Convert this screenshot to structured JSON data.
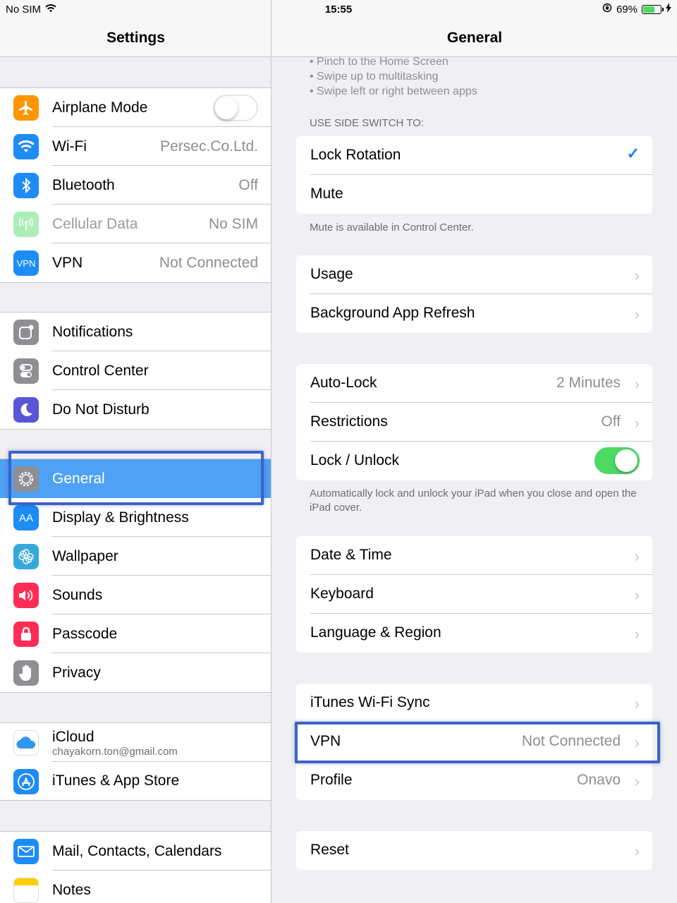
{
  "status": {
    "carrier": "No SIM",
    "time": "15:55",
    "battery": "69%",
    "battery_level": 0.69
  },
  "master": {
    "title": "Settings",
    "group1": [
      {
        "label": "Airplane Mode",
        "icon": "airplane-icon",
        "color": "#ff9500",
        "toggle": false
      },
      {
        "label": "Wi-Fi",
        "value": "Persec.Co.Ltd.",
        "icon": "wifi-icon",
        "color": "#1e8cf5"
      },
      {
        "label": "Bluetooth",
        "value": "Off",
        "icon": "bluetooth-icon",
        "color": "#1e8cf5"
      },
      {
        "label": "Cellular Data",
        "value": "No SIM",
        "icon": "cellular-icon",
        "color": "#4cd964",
        "disabled": true
      },
      {
        "label": "VPN",
        "value": "Not Connected",
        "icon": "vpn-icon",
        "color": "#1e8cf5",
        "icon_text": "VPN"
      }
    ],
    "group2": [
      {
        "label": "Notifications",
        "icon": "notifications-icon",
        "color": "#8e8e93"
      },
      {
        "label": "Control Center",
        "icon": "control-center-icon",
        "color": "#8e8e93"
      },
      {
        "label": "Do Not Disturb",
        "icon": "moon-icon",
        "color": "#5856d6"
      }
    ],
    "group3": [
      {
        "label": "General",
        "icon": "gear-icon",
        "color": "#8e8e93",
        "selected": true
      },
      {
        "label": "Display & Brightness",
        "icon": "display-icon",
        "color": "#1e8cf5",
        "icon_text": "AA"
      },
      {
        "label": "Wallpaper",
        "icon": "wallpaper-icon",
        "color": "#34aadc"
      },
      {
        "label": "Sounds",
        "icon": "speaker-icon",
        "color": "#ff2d55"
      },
      {
        "label": "Passcode",
        "icon": "lock-icon",
        "color": "#ff2d55"
      },
      {
        "label": "Privacy",
        "icon": "hand-icon",
        "color": "#8e8e93"
      }
    ],
    "group4": [
      {
        "label": "iCloud",
        "sublabel": "chayakorn.ton@gmail.com",
        "icon": "icloud-icon",
        "color": "#ffffff"
      },
      {
        "label": "iTunes & App Store",
        "icon": "app-store-icon",
        "color": "#1e8cf5"
      }
    ],
    "group5": [
      {
        "label": "Mail, Contacts, Calendars",
        "icon": "mail-icon",
        "color": "#1e8cf5"
      },
      {
        "label": "Notes",
        "icon": "notes-icon",
        "color": "#ffcc00"
      }
    ]
  },
  "detail": {
    "title": "General",
    "bullets": [
      "• Pinch to the Home Screen",
      "• Swipe up to multitasking",
      "• Swipe left or right between apps"
    ],
    "side_switch_header": "USE SIDE SWITCH TO:",
    "side_switch": [
      {
        "label": "Lock Rotation",
        "checked": true
      },
      {
        "label": "Mute"
      }
    ],
    "side_switch_footer": "Mute is available in Control Center.",
    "group_usage": [
      {
        "label": "Usage"
      },
      {
        "label": "Background App Refresh"
      }
    ],
    "group_lock": [
      {
        "label": "Auto-Lock",
        "value": "2 Minutes"
      },
      {
        "label": "Restrictions",
        "value": "Off"
      },
      {
        "label": "Lock / Unlock",
        "toggle": true
      }
    ],
    "lock_footer": "Automatically lock and unlock your iPad when you close and open the iPad cover.",
    "group_date": [
      {
        "label": "Date & Time"
      },
      {
        "label": "Keyboard"
      },
      {
        "label": "Language & Region"
      }
    ],
    "group_sync": [
      {
        "label": "iTunes Wi-Fi Sync"
      },
      {
        "label": "VPN",
        "value": "Not Connected"
      },
      {
        "label": "Profile",
        "value": "Onavo"
      }
    ],
    "group_reset": [
      {
        "label": "Reset"
      }
    ],
    "chevron": "›",
    "checkmark": "✓"
  }
}
